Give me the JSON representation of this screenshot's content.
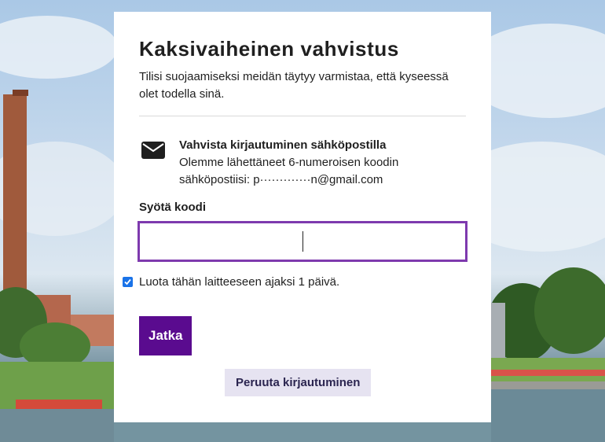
{
  "page": {
    "title": "Kaksivaiheinen vahvistus",
    "subtitle": "Tilisi suojaamiseksi meidän täytyy varmistaa, että kyseessä olet todella sinä."
  },
  "method": {
    "icon": "envelope-icon",
    "heading": "Vahvista kirjautuminen sähköpostilla",
    "description": "Olemme lähettäneet 6-numeroisen koodin sähköpostiisi: p·············n@gmail.com"
  },
  "code": {
    "label": "Syötä koodi",
    "value": ""
  },
  "trust_device": {
    "checked": true,
    "label": "Luota tähän laitteeseen ajaksi 1 päivä."
  },
  "buttons": {
    "continue": "Jatka",
    "cancel": "Peruuta kirjautuminen"
  },
  "colors": {
    "accent": "#7e3aae",
    "primary_button": "#5a0b8f",
    "secondary_button": "#e6e3f1",
    "checkbox": "#1a73e8"
  }
}
